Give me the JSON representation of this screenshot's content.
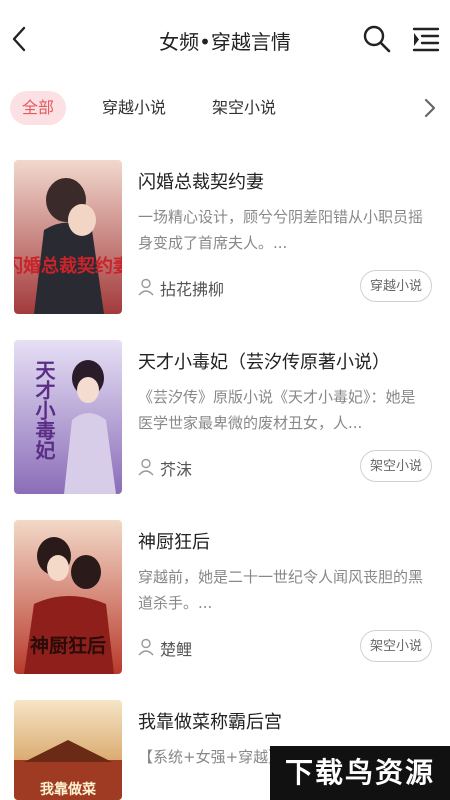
{
  "header": {
    "title": "女频•穿越言情"
  },
  "categories": [
    {
      "label": "全部",
      "active": true
    },
    {
      "label": "穿越小说",
      "active": false
    },
    {
      "label": "架空小说",
      "active": false
    }
  ],
  "books": [
    {
      "title": "闪婚总裁契约妻",
      "desc": "一场精心设计，顾兮兮阴差阳错从小职员摇身变成了首席夫人。...",
      "author": "拈花拂柳",
      "tag": "穿越小说",
      "cover_text": "闪婚总裁契约妻",
      "cover_colors": [
        "#a33a3c",
        "#f1d8cd",
        "#6b1720"
      ]
    },
    {
      "title": "天才小毒妃（芸汐传原著小说）",
      "desc": "《芸汐传》原版小说《天才小毒妃》：她是医学世家最卑微的废材丑女，人...",
      "author": "芥沫",
      "tag": "架空小说",
      "cover_text": "天才小毒妃",
      "cover_colors": [
        "#8b6db8",
        "#e6e0f5",
        "#4b3278"
      ]
    },
    {
      "title": "神厨狂后",
      "desc": "穿越前，她是二十一世纪令人闻风丧胆的黑道杀手。...",
      "author": "楚鲤",
      "tag": "架空小说",
      "cover_text": "神厨狂后",
      "cover_colors": [
        "#b83a2c",
        "#f3d9c8",
        "#5a1a14"
      ]
    },
    {
      "title": "我靠做菜称霸后宫",
      "desc": "【系统+女强+穿越】手，穿成废材王后",
      "author": "",
      "tag": "",
      "cover_text": "我靠做菜",
      "cover_colors": [
        "#c8863a",
        "#f6e5c6",
        "#7a3b15"
      ]
    }
  ],
  "watermark": "下载鸟资源"
}
